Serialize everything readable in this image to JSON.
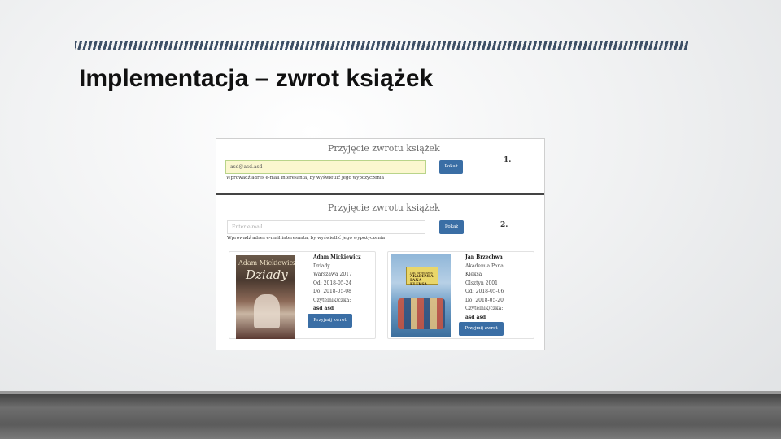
{
  "slide": {
    "title": "Implementacja – zwrot książek"
  },
  "screenshot": {
    "panel1": {
      "heading": "Przyjęcie zwrotu książek",
      "email_value": "asd@asd.asd",
      "show_button": "Pokaż",
      "hint": "Wprowadź adres e-mail interesanta, by wyświetlić jego wypożyczenia",
      "step": "1."
    },
    "panel2": {
      "heading": "Przyjęcie zwrotu książek",
      "email_placeholder": "Enter e-mail",
      "show_button": "Pokaż",
      "hint": "Wprowadź adres e-mail interesanta, by wyświetlić jego wypożyczenia",
      "step": "2.",
      "loans": [
        {
          "cover_author": "Adam Mickiewicz",
          "cover_title": "Dziady",
          "author": "Adam Mickiewicz",
          "title": "Dziady",
          "place_year": "Warszawa 2017",
          "from": "Od: 2018-05-24",
          "to": "Do: 2018-05-08",
          "reader_label": "Czytelnik/czka:",
          "reader": "asd asd",
          "return_button": "Przyjmij zwrot"
        },
        {
          "cover_author": "Jan Brzechwa",
          "cover_title": "AKADEMIA PANA KLEKSA",
          "author": "Jan Brzechwa",
          "title_line1": "Akademia Pana",
          "title_line2": "Kleksa",
          "place_year": "Olsztyn 2001",
          "from": "Od: 2018-05-06",
          "to": "Do: 2018-05-20",
          "reader_label": "Czytelnik/czka:",
          "reader": "asd asd",
          "return_button": "Przyjmij zwrot"
        }
      ]
    }
  }
}
